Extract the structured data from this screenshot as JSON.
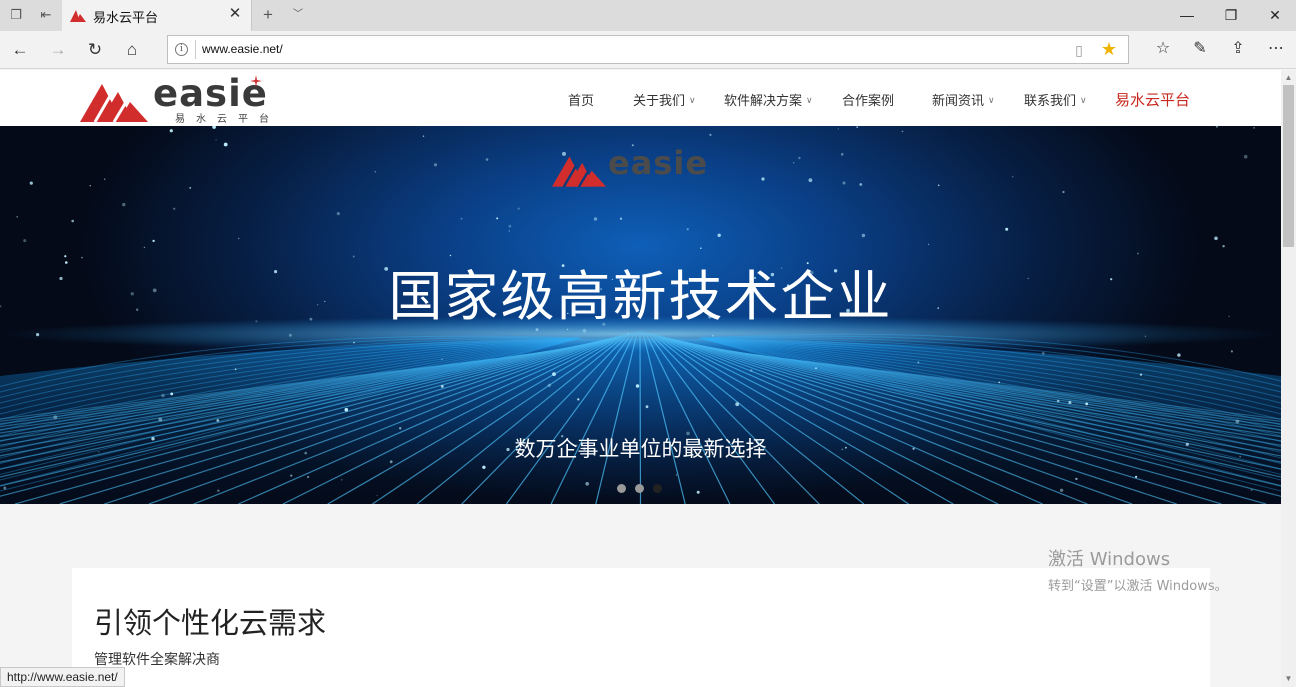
{
  "browser": {
    "tab_title": "易水云平台",
    "url": "www.easie.net/",
    "status_url": "http://www.easie.net/",
    "accent_star": "#f0b400"
  },
  "site": {
    "logo_word": "easie",
    "logo_sub": "易水云平台",
    "brand_red": "#d22d2d",
    "nav": {
      "home": "首页",
      "about": "关于我们",
      "solutions": "软件解决方案",
      "cases": "合作案例",
      "news": "新闻资讯",
      "contact": "联系我们",
      "platform": "易水云平台"
    }
  },
  "banner": {
    "logo_word": "easie",
    "title": "国家级高新技术企业",
    "subtitle": "数万企事业单位的最新选择",
    "slides": 3,
    "active_slide": 3
  },
  "content": {
    "title": "引领个性化云需求",
    "subtitle": "管理软件全案解决商"
  },
  "watermark": {
    "line1": "激活 Windows",
    "line2": "转到“设置”以激活 Windows。"
  }
}
